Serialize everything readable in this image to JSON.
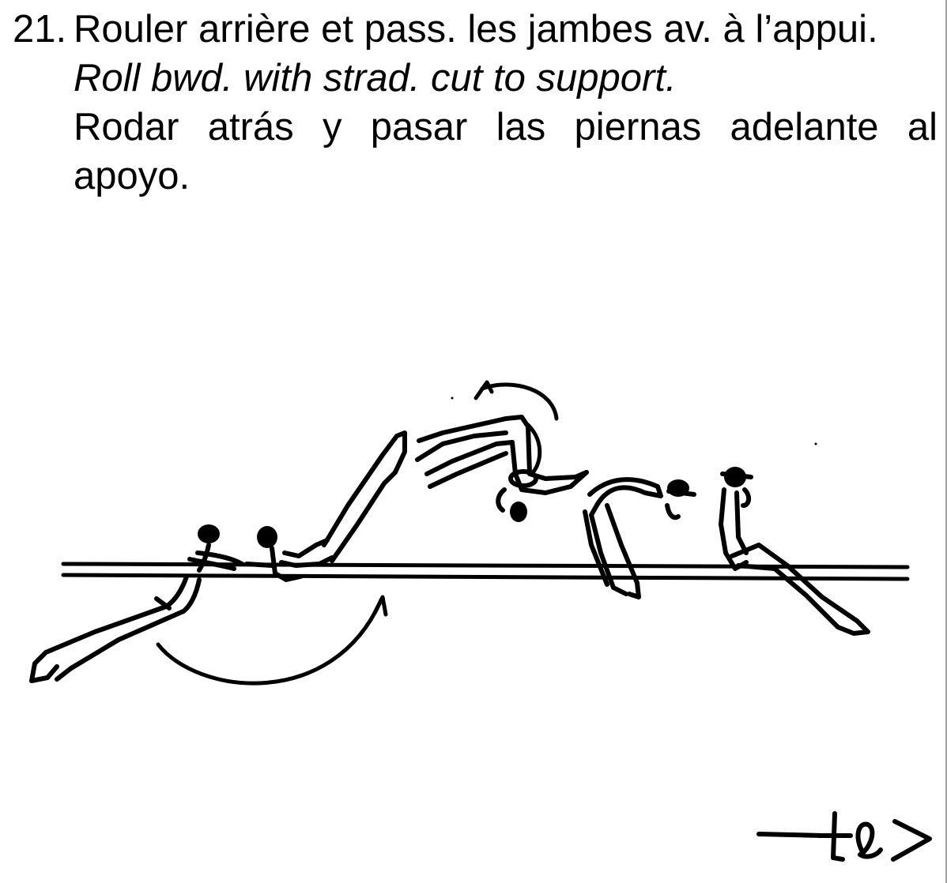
{
  "item": {
    "number": "21.",
    "title_fr": "Rouler arrière et pass. les jambes av. à l’appui.",
    "title_en": "Roll bwd. with strad. cut to support.",
    "title_es_line1": "Rodar atrás y pasar las piernas adelante al",
    "title_es_line2": "apoyo."
  },
  "icons": {
    "figure": "gymnast-sequence-on-parallel-bars",
    "direction": "direction-arrow-icon"
  }
}
